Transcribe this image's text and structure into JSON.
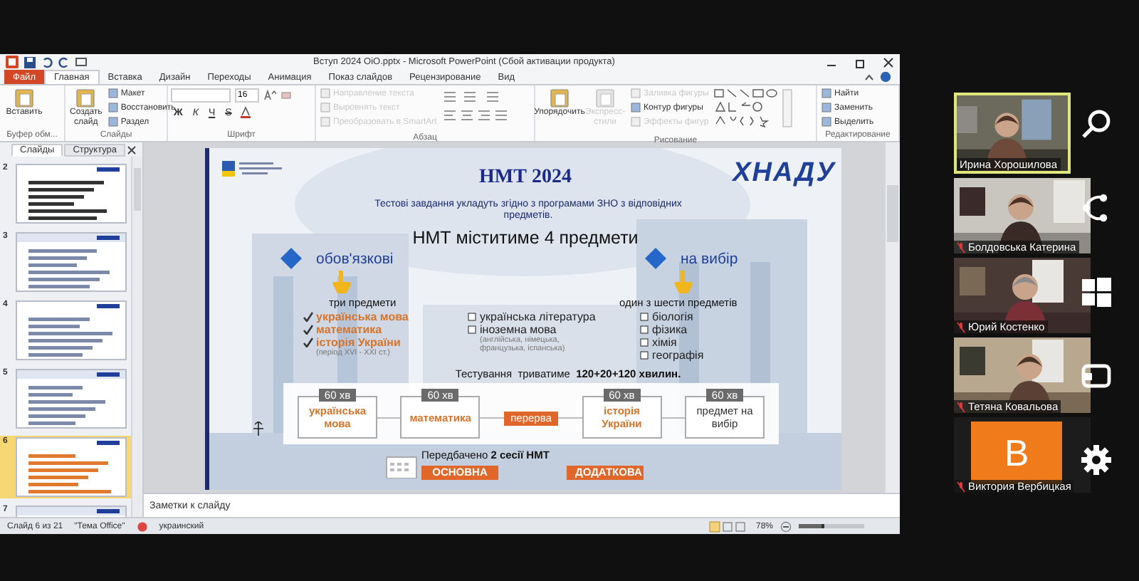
{
  "window": {
    "title": "Вступ 2024 ОіО.pptx - Microsoft PowerPoint (Сбой активации продукта)"
  },
  "ribbon_tabs": [
    {
      "label": "Файл",
      "kind": "file",
      "selected": false
    },
    {
      "label": "Главная",
      "kind": "tab",
      "selected": true
    },
    {
      "label": "Вставка",
      "kind": "tab",
      "selected": false
    },
    {
      "label": "Дизайн",
      "kind": "tab",
      "selected": false
    },
    {
      "label": "Переходы",
      "kind": "tab",
      "selected": false
    },
    {
      "label": "Анимация",
      "kind": "tab",
      "selected": false
    },
    {
      "label": "Показ слайдов",
      "kind": "tab",
      "selected": false
    },
    {
      "label": "Рецензирование",
      "kind": "tab",
      "selected": false
    },
    {
      "label": "Вид",
      "kind": "tab",
      "selected": false
    }
  ],
  "ribbon_groups": [
    {
      "label": "Буфер обм...",
      "commands": [
        {
          "label": "Вставить",
          "kind": "large",
          "disabled": false
        }
      ]
    },
    {
      "label": "Слайды",
      "commands": [
        {
          "label": "Создать слайд",
          "kind": "large",
          "disabled": false
        },
        {
          "label": "Макет",
          "kind": "small",
          "disabled": false
        },
        {
          "label": "Восстановить",
          "kind": "small",
          "disabled": false
        },
        {
          "label": "Раздел",
          "kind": "small",
          "disabled": false
        }
      ]
    },
    {
      "label": "Шрифт",
      "commands": [
        {
          "label": "16",
          "kind": "field"
        },
        {
          "label": "Ж",
          "kind": "format"
        },
        {
          "label": "К",
          "kind": "format"
        },
        {
          "label": "Ч",
          "kind": "format"
        },
        {
          "label": "S",
          "kind": "format"
        }
      ]
    },
    {
      "label": "Абзац",
      "commands": [
        {
          "label": "Направление текста",
          "kind": "small",
          "disabled": true
        },
        {
          "label": "Выровнять текст",
          "kind": "small",
          "disabled": true
        },
        {
          "label": "Преобразовать в SmartArt",
          "kind": "small",
          "disabled": true
        }
      ]
    },
    {
      "label": "Рисование",
      "commands": [
        {
          "label": "Упорядочить",
          "kind": "large",
          "disabled": false
        },
        {
          "label": "Экспресс-стили",
          "kind": "large",
          "disabled": true
        },
        {
          "label": "Заливка фигуры",
          "kind": "small",
          "disabled": true
        },
        {
          "label": "Контур фигуры",
          "kind": "small",
          "disabled": false
        },
        {
          "label": "Эффекты фигур",
          "kind": "small",
          "disabled": true
        }
      ]
    },
    {
      "label": "Редактирование",
      "commands": [
        {
          "label": "Найти",
          "kind": "small",
          "disabled": false
        },
        {
          "label": "Заменить",
          "kind": "small",
          "disabled": false
        },
        {
          "label": "Выделить",
          "kind": "small",
          "disabled": false
        }
      ]
    }
  ],
  "pane_tabs": [
    {
      "label": "Слайды",
      "selected": true
    },
    {
      "label": "Структура",
      "selected": false
    }
  ],
  "thumbnails": [
    {
      "number": "2",
      "selected": false
    },
    {
      "number": "3",
      "selected": false
    },
    {
      "number": "4",
      "selected": false
    },
    {
      "number": "5",
      "selected": false
    },
    {
      "number": "6",
      "selected": true
    },
    {
      "number": "7",
      "selected": false
    }
  ],
  "slide": {
    "logo": "ХНАДУ",
    "title": "НМТ 2024",
    "subtitle": "Тестові завдання укладуть згідно з програмами ЗНО з відповідних предметів.",
    "heading": "НМТ міститиме 4 предмети",
    "columns": [
      {
        "label": "обов'язкові",
        "caption": "три предмети"
      },
      {
        "label": "на вибір",
        "caption": "один з шести предметів"
      }
    ],
    "lists": [
      {
        "items": [
          {
            "label": "українська мова",
            "checked": true
          },
          {
            "label": "математика",
            "checked": true
          },
          {
            "label": "історія України",
            "checked": true,
            "note": "(період XVI - XXI ст.)"
          }
        ]
      },
      {
        "items": [
          {
            "label": "українська література",
            "checked": false
          },
          {
            "label": "іноземна мова",
            "checked": false,
            "note": "(англійська, німецька, французька, іспанська)"
          }
        ]
      },
      {
        "items": [
          {
            "label": "біологія",
            "checked": false
          },
          {
            "label": "фізика",
            "checked": false
          },
          {
            "label": "хімія",
            "checked": false
          },
          {
            "label": "географія",
            "checked": false
          }
        ]
      }
    ],
    "duration_text": "Тестування  триватиме  **120+20+120 хвилин.**",
    "schedule": [
      {
        "time": "60 хв",
        "label": "українська мова",
        "kind": "subject"
      },
      {
        "time": "60 хв",
        "label": "математика",
        "kind": "subject"
      },
      {
        "label": "перерва",
        "kind": "break"
      },
      {
        "time": "60 хв",
        "label": "історія України",
        "kind": "subject"
      },
      {
        "time": "60 хв",
        "label": "предмет на вибір",
        "kind": "elective"
      }
    ],
    "sessions_text": "Передбачено **2 сесії НМТ**",
    "sessions": [
      "ОСНОВНА",
      "ДОДАТКОВА"
    ]
  },
  "notes_placeholder": "Заметки к слайду",
  "status_bar": {
    "slide": "Слайд 6 из 21",
    "theme": "\"Тема Office\"",
    "language": "украинский",
    "zoom": "78%",
    "zoom_slider": {
      "level": 0.4
    }
  },
  "participants": [
    {
      "name": "Ирина Хорошилова",
      "kind": "video",
      "active": true,
      "muted": false
    },
    {
      "name": "Болдовська Катерина",
      "kind": "video",
      "active": false,
      "muted": true
    },
    {
      "name": "Юрий Костенко",
      "kind": "video",
      "active": false,
      "muted": true
    },
    {
      "name": "Тетяна Ковальова",
      "kind": "video",
      "active": false,
      "muted": true
    },
    {
      "name": "Виктория Вербицкая",
      "kind": "avatar",
      "initial": "В",
      "active": false,
      "muted": true
    }
  ]
}
